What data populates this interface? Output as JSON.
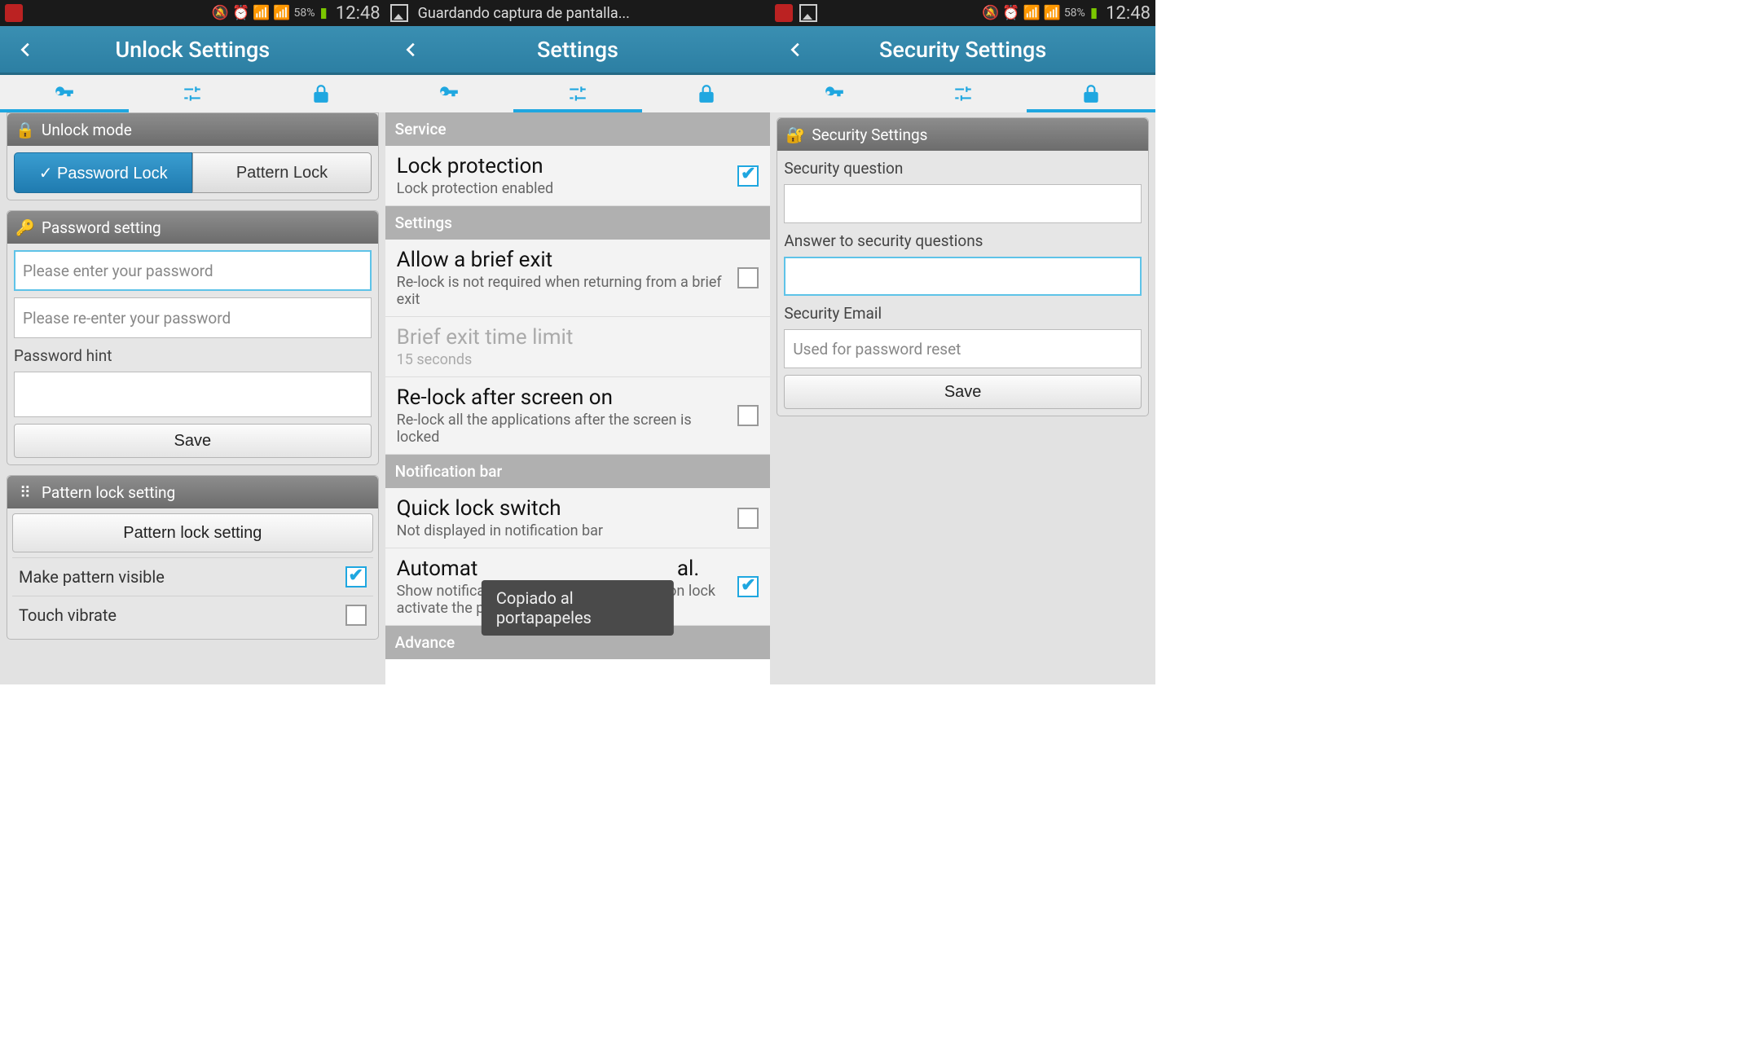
{
  "status": {
    "battery_pct": "58%",
    "time": "12:48",
    "saving_text": "Guardando captura de pantalla..."
  },
  "screens": [
    {
      "title": "Unlock Settings",
      "active_tab": 0,
      "unlock_mode_header": "Unlock mode",
      "password_lock_label": "Password Lock",
      "pattern_lock_label": "Pattern Lock",
      "password_setting_header": "Password setting",
      "password_placeholder": "Please enter your password",
      "password_confirm_placeholder": "Please re-enter your password",
      "password_hint_label": "Password hint",
      "save_label": "Save",
      "pattern_setting_header": "Pattern lock setting",
      "pattern_setting_button": "Pattern lock setting",
      "make_pattern_visible_label": "Make pattern visible",
      "make_pattern_visible_checked": true,
      "touch_vibrate_label": "Touch vibrate",
      "touch_vibrate_checked": false
    },
    {
      "title": "Settings",
      "active_tab": 1,
      "sections": {
        "service": "Service",
        "settings": "Settings",
        "notification": "Notification bar",
        "advance": "Advance"
      },
      "items": {
        "lock_protection": {
          "title": "Lock protection",
          "sub": "Lock protection enabled",
          "checked": true
        },
        "brief_exit": {
          "title": "Allow a brief exit",
          "sub": "Re-lock is not required when returning from a brief exit",
          "checked": false
        },
        "brief_limit": {
          "title": "Brief exit time limit",
          "sub": "15 seconds"
        },
        "relock": {
          "title": "Re-lock after screen on",
          "sub": "Re-lock all the applications after the screen is locked",
          "checked": false
        },
        "quick_lock": {
          "title": "Quick lock switch",
          "sub": "Not displayed in notification bar",
          "checked": false
        },
        "auto_notify": {
          "title": "Automat",
          "title_suffix": "al.",
          "sub": "Show notification when time lock or location lock activate the profile",
          "checked": true
        }
      },
      "toast": "Copiado al portapapeles"
    },
    {
      "title": "Security Settings",
      "active_tab": 2,
      "panel_header": "Security Settings",
      "security_question_label": "Security question",
      "answer_label": "Answer to security questions",
      "email_label": "Security Email",
      "email_placeholder": "Used for password reset",
      "save_label": "Save"
    }
  ]
}
